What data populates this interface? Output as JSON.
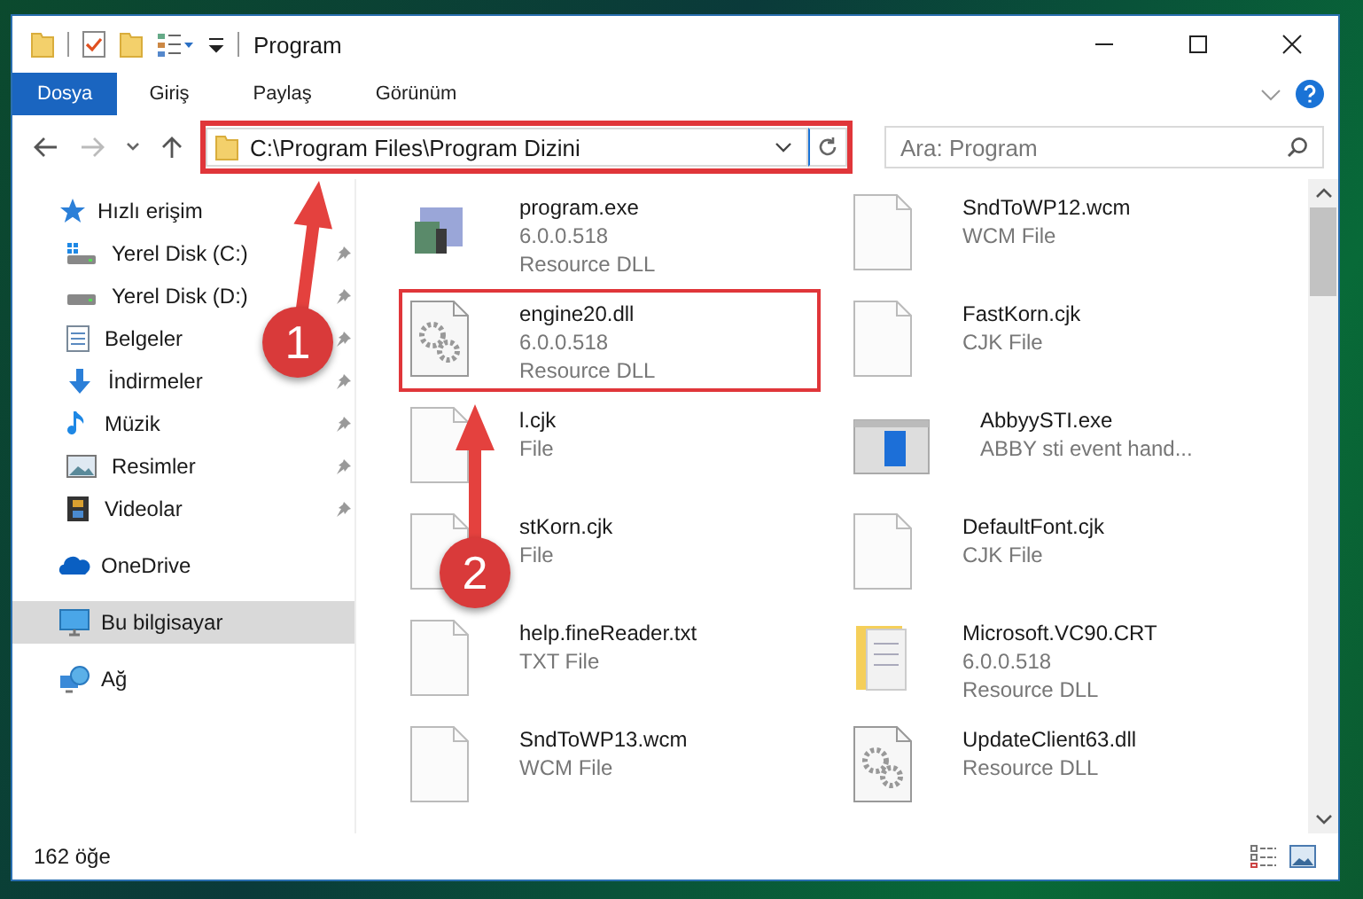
{
  "window": {
    "title": "Program"
  },
  "ribbon_tabs": [
    {
      "label": "Dosya",
      "selected": true
    },
    {
      "label": "Giriş",
      "selected": false
    },
    {
      "label": "Paylaş",
      "selected": false
    },
    {
      "label": "Görünüm",
      "selected": false
    }
  ],
  "address": {
    "path": "C:\\Program Files\\Program Dizini",
    "highlighted": true
  },
  "search": {
    "placeholder": "Ara: Program"
  },
  "sidebar": {
    "items": [
      {
        "label": "Hızlı erişim",
        "kind": "star",
        "selected": false,
        "children": [
          {
            "label": "Yerel Disk (C:)",
            "kind": "system-drive",
            "pinned": true
          },
          {
            "label": "Yerel Disk (D:)",
            "kind": "drive",
            "pinned": true
          },
          {
            "label": "Belgeler",
            "kind": "documents",
            "pinned": true
          },
          {
            "label": "İndirmeler",
            "kind": "download",
            "pinned": true
          },
          {
            "label": "Müzik",
            "kind": "music",
            "pinned": true
          },
          {
            "label": "Resimler",
            "kind": "pictures",
            "pinned": true
          },
          {
            "label": "Videolar",
            "kind": "videos",
            "pinned": true
          }
        ]
      },
      {
        "label": "OneDrive",
        "kind": "cloud",
        "selected": false
      },
      {
        "label": "Bu bilgisayar",
        "kind": "computer",
        "selected": true
      },
      {
        "label": "Ağ",
        "kind": "network",
        "selected": false
      }
    ]
  },
  "files": [
    {
      "kind": "app",
      "lines": [
        "program.exe",
        "6.0.0.518",
        "Resource DLL"
      ],
      "highlighted": false
    },
    {
      "kind": "blank",
      "lines": [
        "SndToWP12.wcm",
        "WCM File"
      ],
      "highlighted": false
    },
    {
      "kind": "gears",
      "lines": [
        "engine20.dll",
        "6.0.0.518",
        "Resource DLL"
      ],
      "highlighted": true
    },
    {
      "kind": "blank",
      "lines": [
        "FastKorn.cjk",
        "CJK File"
      ],
      "highlighted": false
    },
    {
      "kind": "blank",
      "lines": [
        "l.cjk",
        "File"
      ],
      "highlighted": false
    },
    {
      "kind": "window",
      "lines": [
        "AbbyySTI.exe",
        "ABBY sti event hand..."
      ],
      "highlighted": false
    },
    {
      "kind": "blank",
      "lines": [
        "stKorn.cjk",
        "File"
      ],
      "highlighted": false
    },
    {
      "kind": "blank",
      "lines": [
        "DefaultFont.cjk",
        "CJK File"
      ],
      "highlighted": false
    },
    {
      "kind": "blank",
      "lines": [
        "help.fineReader.txt",
        "TXT File"
      ],
      "highlighted": false
    },
    {
      "kind": "package",
      "lines": [
        "Microsoft.VC90.CRT",
        "6.0.0.518",
        "Resource DLL"
      ],
      "highlighted": false
    },
    {
      "kind": "blank",
      "lines": [
        "SndToWP13.wcm",
        "WCM File"
      ],
      "highlighted": false
    },
    {
      "kind": "gears",
      "lines": [
        "UpdateClient63.dll",
        "Resource DLL"
      ],
      "highlighted": false
    }
  ],
  "status_bar": {
    "count": "162 öğe"
  },
  "annotations": [
    {
      "number": "1"
    },
    {
      "number": "2"
    }
  ]
}
